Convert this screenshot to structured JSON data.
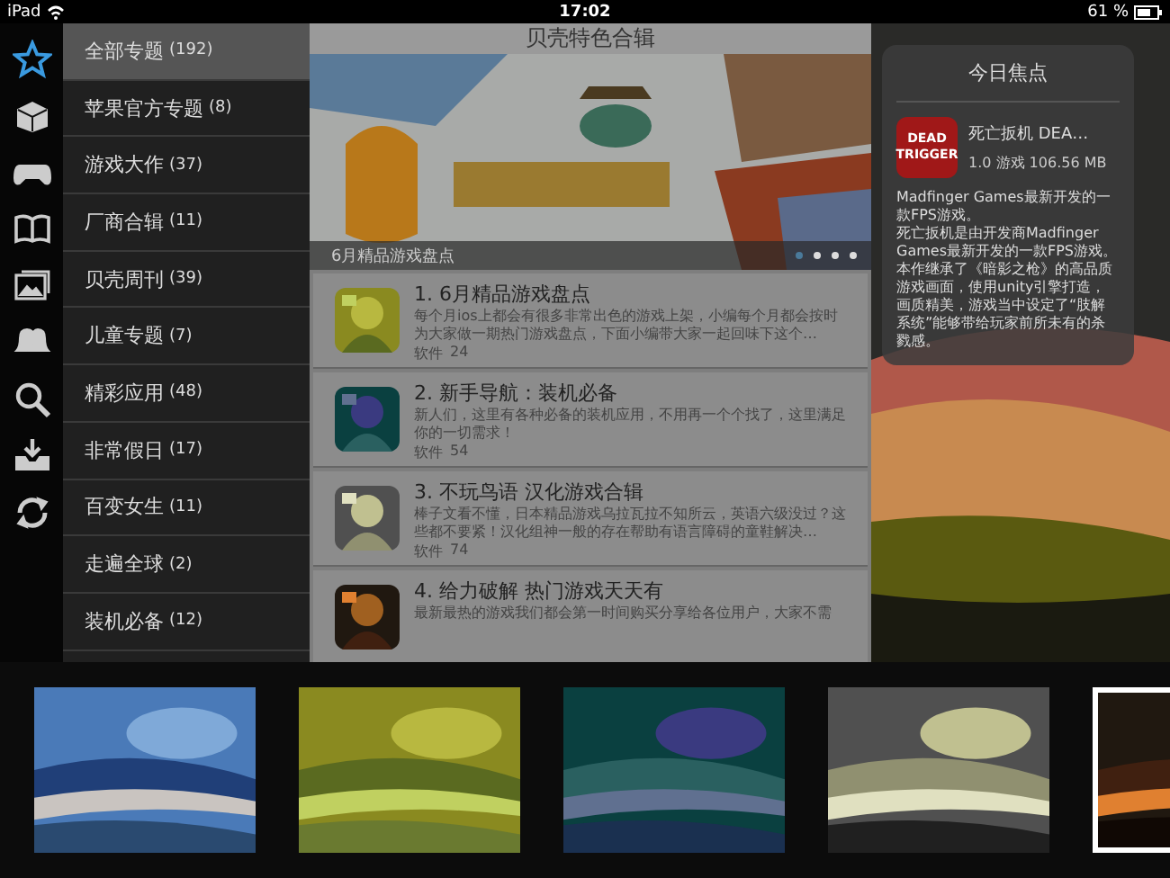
{
  "status_bar": {
    "device": "iPad",
    "time": "17:02",
    "battery": "61 %"
  },
  "side_icons": [
    {
      "kind": "star",
      "selected": true
    },
    {
      "kind": "box",
      "selected": false
    },
    {
      "kind": "gamepad",
      "selected": false
    },
    {
      "kind": "book",
      "selected": false
    },
    {
      "kind": "photos",
      "selected": false
    },
    {
      "kind": "bells",
      "selected": false
    },
    {
      "kind": "search",
      "selected": false
    },
    {
      "kind": "inbox",
      "selected": false
    },
    {
      "kind": "refresh",
      "selected": false
    }
  ],
  "menu": [
    {
      "label": "全部专题",
      "count": "(192)",
      "selected": true
    },
    {
      "label": "苹果官方专题",
      "count": "(8)",
      "selected": false
    },
    {
      "label": "游戏大作",
      "count": "(37)",
      "selected": false
    },
    {
      "label": "厂商合辑",
      "count": "(11)",
      "selected": false
    },
    {
      "label": "贝壳周刊",
      "count": "(39)",
      "selected": false
    },
    {
      "label": "儿童专题",
      "count": "(7)",
      "selected": false
    },
    {
      "label": "精彩应用",
      "count": "(48)",
      "selected": false
    },
    {
      "label": "非常假日",
      "count": "(17)",
      "selected": false
    },
    {
      "label": "百变女生",
      "count": "(11)",
      "selected": false
    },
    {
      "label": "走遍全球",
      "count": "(2)",
      "selected": false
    },
    {
      "label": "装机必备",
      "count": "(12)",
      "selected": false
    }
  ],
  "center": {
    "title": "贝壳特色合辑",
    "banner": {
      "kind": "picture",
      "caption": "6月精品游戏盘点",
      "dots": [
        {
          "selected": true
        },
        {
          "selected": false
        },
        {
          "selected": false
        },
        {
          "selected": false
        }
      ]
    },
    "articles": [
      {
        "title": "1. 6月精品游戏盘点",
        "description": "每个月ios上都会有很多非常出色的游戏上架，小编每个月都会按时为大家做一期热门游戏盘点，下面小编带大家一起回味下这个…",
        "category": "软件",
        "count": "24"
      },
      {
        "title": "2. 新手导航：装机必备",
        "description": "新人们，这里有各种必备的装机应用，不用再一个个找了，这里满足你的一切需求！",
        "category": "软件",
        "count": "54"
      },
      {
        "title": "3. 不玩鸟语 汉化游戏合辑",
        "description": "棒子文看不懂，日本精品游戏乌拉瓦拉不知所云，英语六级没过？这些都不要紧！汉化组神一般的存在帮助有语言障碍的童鞋解决…",
        "category": "软件",
        "count": "74"
      },
      {
        "title": "4. 给力破解 热门游戏天天有",
        "description": "最新最热的游戏我们都会第一时间购买分享给各位用户，大家不需"
      }
    ]
  },
  "focus": {
    "title": "今日焦点",
    "app_icon_text": [
      "DEAD",
      "TRIGGER"
    ],
    "app_name": "死亡扳机 DEA…",
    "meta": "1.0 游戏 106.56 MB",
    "description": [
      "Madfinger Games最新开发的一款FPS游戏。",
      "死亡扳机是由开发商Madfinger Games最新开发的一款FPS游戏。本作继承了《暗影之枪》的高品质游戏画面，使用unity引擎打造，画质精美，游戏当中设定了“肢解系统”能够带给玩家前所未有的杀戮感。"
    ]
  },
  "wallpapers": [
    {
      "selected": false
    },
    {
      "selected": false
    },
    {
      "selected": false
    },
    {
      "selected": false
    },
    {
      "selected": true
    }
  ]
}
